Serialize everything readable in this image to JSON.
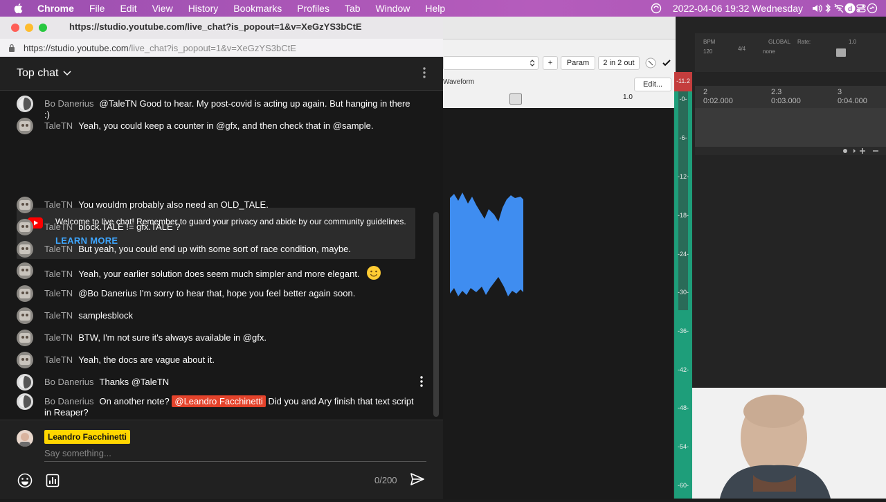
{
  "menubar": {
    "app": "Chrome",
    "items": [
      "File",
      "Edit",
      "View",
      "History",
      "Bookmarks",
      "Profiles",
      "Tab",
      "Window",
      "Help"
    ],
    "clock": "2022-04-06  19:32  Wednesday"
  },
  "window": {
    "title": "https://studio.youtube.com/live_chat?is_popout=1&v=XeGzYS3bCtE",
    "url_host": "https://studio.youtube.com",
    "url_path": "/live_chat?is_popout=1&v=XeGzYS3bCtE"
  },
  "chat": {
    "mode_label": "Top chat",
    "messages": [
      {
        "author": "Bo Danerius",
        "text": "@TaleTN Good to hear. My post-covid is acting up again. But hanging in there :)"
      },
      {
        "author": "TaleTN",
        "text": "Yeah, you could keep a counter in @gfx, and then check that in @sample."
      },
      {
        "author": "TaleTN",
        "text": "You wouldm probably also need an OLD_TALE."
      },
      {
        "author": "TaleTN",
        "text": "block.TALE != gfx.TALE ?"
      },
      {
        "author": "TaleTN",
        "text": "But yeah, you could end up with some sort of race condition, maybe."
      },
      {
        "author": "TaleTN",
        "text": "Yeah, your earlier solution does seem much simpler and more elegant."
      },
      {
        "author": "TaleTN",
        "text": "@Bo Danerius I'm sorry to hear that, hope you feel better again soon."
      },
      {
        "author": "TaleTN",
        "text": "samplesblock"
      },
      {
        "author": "TaleTN",
        "text": "BTW, I'm not sure it's always available in @gfx."
      },
      {
        "author": "TaleTN",
        "text": "Yeah, the docs are vague about it."
      },
      {
        "author": "Bo Danerius",
        "text": "Thanks @TaleTN"
      },
      {
        "author": "Bo Danerius",
        "text_before": "On another note?",
        "mention": "@Leandro Facchinetti",
        "text_after": "Did you and Ary finish that text script in Reaper?"
      }
    ],
    "banner": {
      "text": "Welcome to live chat! Remember to guard your privacy and abide by our community guidelines.",
      "link": "LEARN MORE"
    },
    "composer": {
      "user": "Leandro Facchinetti",
      "placeholder": "Say something...",
      "counter": "0/200"
    }
  },
  "daw": {
    "fx_buttons": [
      "+",
      "Param",
      "2 in 2 out"
    ],
    "fx_label": "Waveform",
    "fx_edit": "Edit...",
    "fx_value": "1.0",
    "meter_ticks": [
      "-11.2",
      "-0-",
      "-6-",
      "-12-",
      "-18-",
      "-24-",
      "-30-",
      "-36-",
      "-42-",
      "-48-",
      "-54-",
      "-60-"
    ],
    "transport": {
      "bpm": "BPM",
      "bpm_value": "120",
      "sig": "4/4",
      "global": "GLOBAL",
      "none": "none",
      "rate": "Rate:",
      "rate_value": "1.0"
    },
    "ruler": [
      {
        "bar": "2",
        "time": "0:02.000"
      },
      {
        "bar": "2.3",
        "time": "0:03.000"
      },
      {
        "bar": "3",
        "time": "0:04.000"
      }
    ]
  },
  "colors": {
    "mention": "#e4432b",
    "owner_badge": "#ffd600",
    "link": "#3ea6ff",
    "waveform": "#3f8df0",
    "meter": "#1e9e7a"
  }
}
